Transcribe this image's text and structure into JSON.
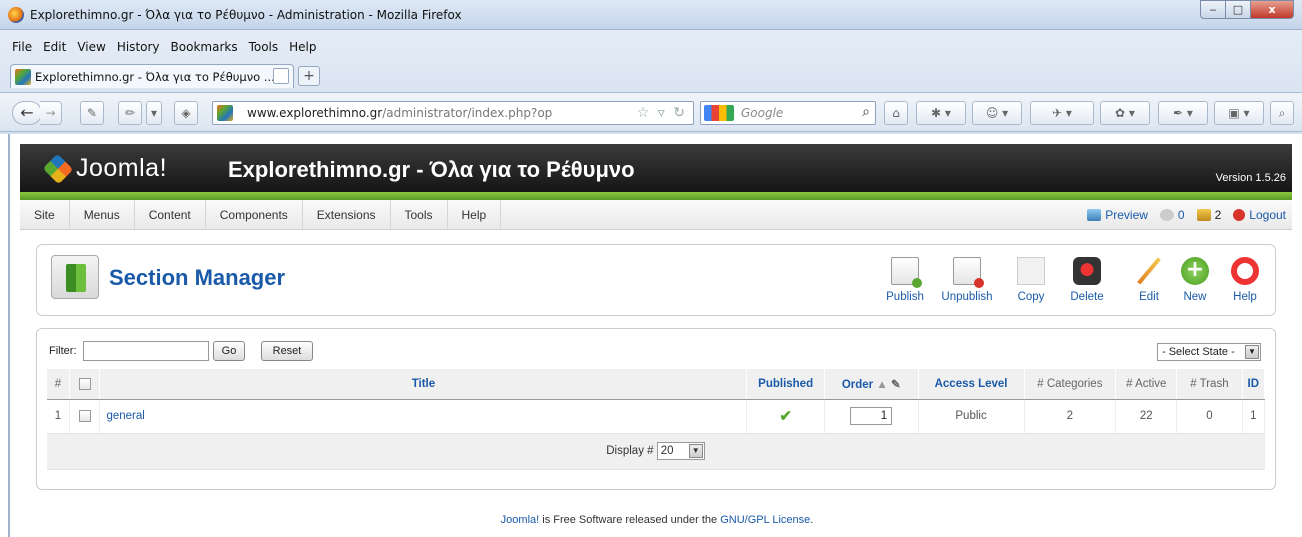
{
  "window": {
    "title": "Explorethimno.gr - Όλα για το Ρέθυμνο - Administration - Mozilla Firefox",
    "min": "‒",
    "max": "□",
    "close": "x"
  },
  "menubar": [
    "File",
    "Edit",
    "View",
    "History",
    "Bookmarks",
    "Tools",
    "Help"
  ],
  "tab": {
    "title": "Explorethimno.gr - Όλα για το Ρέθυμνο ...",
    "new_tab": "+"
  },
  "urlbar": {
    "domain": "www.explorethimno.gr",
    "path": "/administrator/index.php?op"
  },
  "search": {
    "placeholder": "Google",
    "icon": "⌕"
  },
  "joomla": {
    "logo": "Joomla!",
    "site_title": "Explorethimno.gr - Όλα για το Ρέθυμνο",
    "version": "Version 1.5.26"
  },
  "admin_menu": [
    "Site",
    "Menus",
    "Content",
    "Components",
    "Extensions",
    "Tools",
    "Help"
  ],
  "status": {
    "preview": "Preview",
    "messages": "0",
    "users": "2",
    "logout": "Logout"
  },
  "page": {
    "title": "Section Manager"
  },
  "toolbar": [
    "Publish",
    "Unpublish",
    "Copy",
    "Delete",
    "Edit",
    "New",
    "Help"
  ],
  "filter": {
    "label": "Filter:",
    "value": "",
    "go": "Go",
    "reset": "Reset",
    "state": "- Select State -"
  },
  "table": {
    "headers": {
      "num": "#",
      "title": "Title",
      "published": "Published",
      "order": "Order",
      "access": "Access Level",
      "categories": "# Categories",
      "active": "# Active",
      "trash": "# Trash",
      "id": "ID"
    },
    "rows": [
      {
        "num": "1",
        "title": "general",
        "published": "✔",
        "order": "1",
        "access": "Public",
        "categories": "2",
        "active": "22",
        "trash": "0",
        "id": "1"
      }
    ],
    "display_label": "Display #",
    "display_value": "20"
  },
  "footer": {
    "joomla": "Joomla!",
    "text1": " is Free Software released under the ",
    "license": "GNU/GPL License",
    "text2": "."
  }
}
